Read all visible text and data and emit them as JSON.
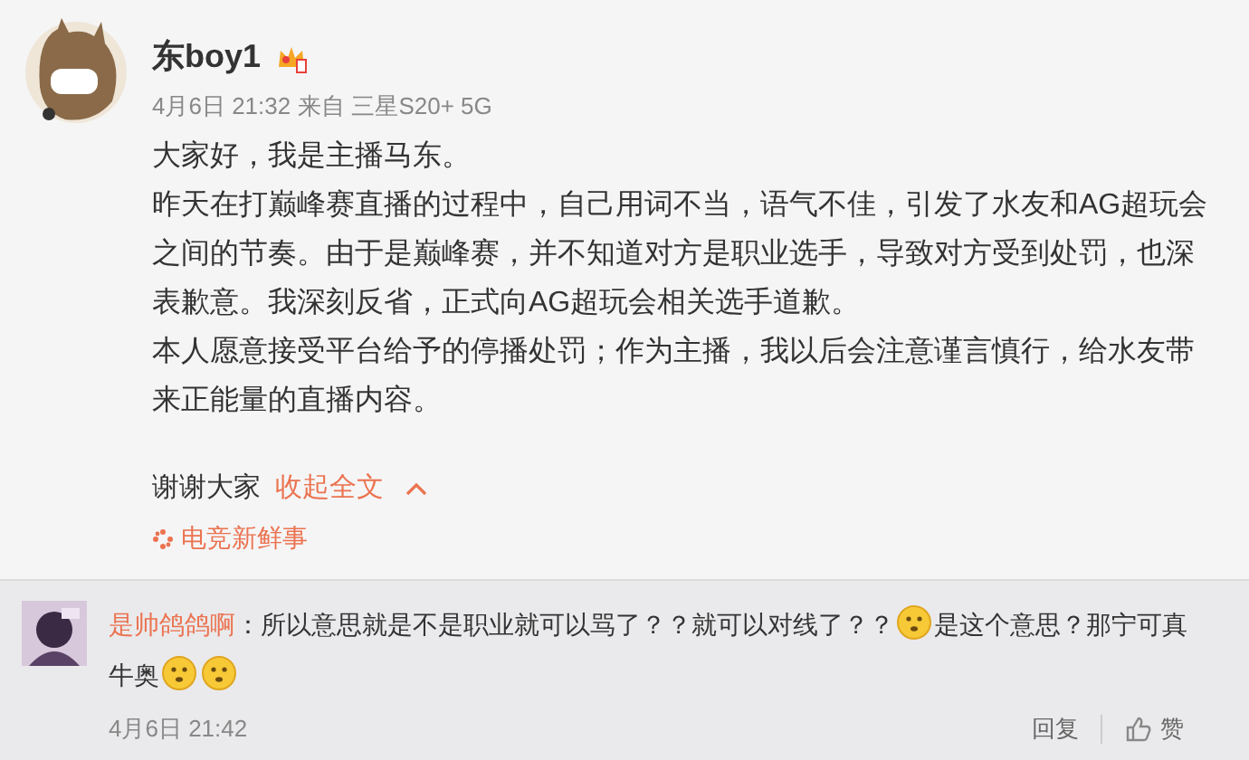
{
  "post": {
    "author": "东boy1",
    "time": "4月6日 21:32",
    "source": "来自 三星S20+ 5G",
    "paragraphs": [
      "大家好，我是主播马东。",
      "昨天在打巅峰赛直播的过程中，自己用词不当，语气不佳，引发了水友和AG超玩会之间的节奏。由于是巅峰赛，并不知道对方是职业选手，导致对方受到处罚，也深表歉意。我深刻反省，正式向AG超玩会相关选手道歉。",
      "本人愿意接受平台给予的停播处罚；作为主播，我以后会注意谨言慎行，给水友带来正能量的直播内容。"
    ],
    "closing": "谢谢大家",
    "collapse_link": "收起全文",
    "topic": "电竞新鲜事"
  },
  "comment": {
    "user": "是帅鸽鸽啊",
    "segments": [
      {
        "kind": "text",
        "text": "：所以意思就是不是职业就可以骂了？？就可以对线了？？"
      },
      {
        "kind": "emoji"
      },
      {
        "kind": "text",
        "text": "是这个意思？那宁可真牛奥"
      },
      {
        "kind": "emoji"
      },
      {
        "kind": "emoji"
      }
    ],
    "time": "4月6日 21:42",
    "actions": [
      "回复",
      "赞"
    ]
  }
}
